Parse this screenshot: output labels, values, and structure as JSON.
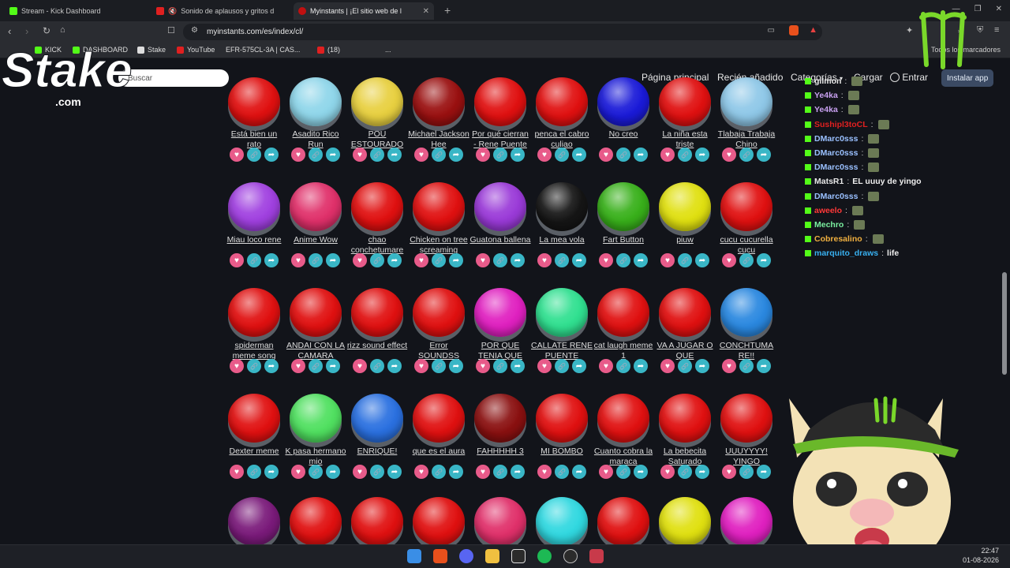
{
  "browser": {
    "tabs": [
      {
        "title": "Stream - Kick Dashboard",
        "active": false
      },
      {
        "title": "Sonido de aplausos y gritos d",
        "active": false
      },
      {
        "title": "Myinstants | ¡El sitio web de l",
        "active": true
      }
    ],
    "url": "myinstants.com/es/index/cl/",
    "bookmarks": [
      "KICK",
      "DASHBOARD",
      "Stake",
      "YouTube",
      "EFR-575CL-3A | CAS...",
      "(18)",
      "..."
    ],
    "bookmarks_right": "Todos los marcadores"
  },
  "site": {
    "search_placeholder": "Buscar",
    "nav": [
      "Página principal",
      "Recién añadido",
      "Categorías",
      "Cargar",
      "Entrar"
    ],
    "install_label": "Instalar app"
  },
  "grid": {
    "rows": [
      [
        {
          "label": "Está bien un rato",
          "color": "#e01010"
        },
        {
          "label": "Asadito Rico Run",
          "color": "#8fd6ea"
        },
        {
          "label": "POU ESTOURADO",
          "color": "#e8d040"
        },
        {
          "label": "Michael Jackson Hee",
          "color": "#9a1010"
        },
        {
          "label": "Por qué cierran - Rene Puente",
          "color": "#e01010"
        },
        {
          "label": "penca el cabro culiao",
          "color": "#e01010"
        },
        {
          "label": "No creo",
          "color": "#1a1ad8"
        },
        {
          "label": "La niña esta triste",
          "color": "#e01010"
        },
        {
          "label": "Tlabaja Trabaja Chino",
          "color": "#8fc8e8"
        }
      ],
      [
        {
          "label": "Miau loco rene",
          "color": "#a040e0"
        },
        {
          "label": "Anime Wow",
          "color": "#e0306a"
        },
        {
          "label": "chao conchetumare",
          "color": "#e01010"
        },
        {
          "label": "Chicken on tree screaming",
          "color": "#e01010"
        },
        {
          "label": "Guatona ballena",
          "color": "#9a3ad8"
        },
        {
          "label": "La mea vola",
          "color": "#151515"
        },
        {
          "label": "Fart Button",
          "color": "#38b01a"
        },
        {
          "label": "piuw",
          "color": "#e0e010"
        },
        {
          "label": "cucu cucurella cucu",
          "color": "#e01010"
        }
      ],
      [
        {
          "label": "spiderman meme song",
          "color": "#e01010"
        },
        {
          "label": "ANDAI CON LA CAMARA",
          "color": "#e01010"
        },
        {
          "label": "rizz sound effect",
          "color": "#e01010"
        },
        {
          "label": "Error SOUNDSS",
          "color": "#e01010"
        },
        {
          "label": "POR QUE TENIA QUE",
          "color": "#e020c0"
        },
        {
          "label": "CALLATE RENE PUENTE",
          "color": "#30e090"
        },
        {
          "label": "cat laugh meme 1",
          "color": "#e01010"
        },
        {
          "label": "VA A JUGAR O QUE",
          "color": "#e01010"
        },
        {
          "label": "CONCHTUMA RE!!",
          "color": "#2a88e0"
        }
      ],
      [
        {
          "label": "Dexter meme",
          "color": "#e01010"
        },
        {
          "label": "K pasa hermano mio",
          "color": "#50e060"
        },
        {
          "label": "ENRIQUE!",
          "color": "#2a70e0"
        },
        {
          "label": "que es el aura",
          "color": "#e01010"
        },
        {
          "label": "FAHHHHH 3",
          "color": "#8a1010"
        },
        {
          "label": "MI BOMBO",
          "color": "#e01010"
        },
        {
          "label": "Cuanto cobra la maraca",
          "color": "#e01010"
        },
        {
          "label": "La bebecita Saturado",
          "color": "#e01010"
        },
        {
          "label": "UUUYYYY! YINGO",
          "color": "#e01010"
        }
      ],
      [
        {
          "label": "",
          "color": "#7a1a7a"
        },
        {
          "label": "",
          "color": "#e01010"
        },
        {
          "label": "",
          "color": "#e01010"
        },
        {
          "label": "",
          "color": "#e01010"
        },
        {
          "label": "",
          "color": "#e0306a"
        },
        {
          "label": "",
          "color": "#30d8e0"
        },
        {
          "label": "",
          "color": "#e01010"
        },
        {
          "label": "",
          "color": "#e0e010"
        },
        {
          "label": "",
          "color": "#e020c0"
        }
      ]
    ]
  },
  "chat": [
    {
      "user": "gilmon",
      "text": "",
      "color": "#e8e8e8",
      "emote": true
    },
    {
      "user": "Ye4ka",
      "text": "",
      "color": "#c8a0f0",
      "emote": true
    },
    {
      "user": "Ye4ka",
      "text": "",
      "color": "#c8a0f0",
      "emote": true
    },
    {
      "user": "Sushipl3toCL",
      "text": "",
      "color": "#e02020",
      "emote": true
    },
    {
      "user": "DMarc0sss",
      "text": "",
      "color": "#9ac0ff",
      "emote": true
    },
    {
      "user": "DMarc0sss",
      "text": "",
      "color": "#9ac0ff",
      "emote": true
    },
    {
      "user": "DMarc0sss",
      "text": "",
      "color": "#9ac0ff",
      "emote": true
    },
    {
      "user": "MatsR1",
      "text": "EL uuuy de yingo",
      "color": "#e8e8e8",
      "emote": false
    },
    {
      "user": "DMarc0sss",
      "text": "",
      "color": "#9ac0ff",
      "emote": true
    },
    {
      "user": "aweelo",
      "text": "",
      "color": "#ff3838",
      "emote": true
    },
    {
      "user": "Mechro",
      "text": "",
      "color": "#7af0a0",
      "emote": true
    },
    {
      "user": "Cobresalino",
      "text": "",
      "color": "#f0b040",
      "emote": true
    },
    {
      "user": "marquito_draws",
      "text": "life",
      "color": "#38b0f0",
      "emote": false
    }
  ],
  "taskbar": {
    "time": "22:47",
    "date": "01-08-2026"
  },
  "overlays": {
    "stake_logo": "Stake",
    "stake_sub": ".com"
  }
}
